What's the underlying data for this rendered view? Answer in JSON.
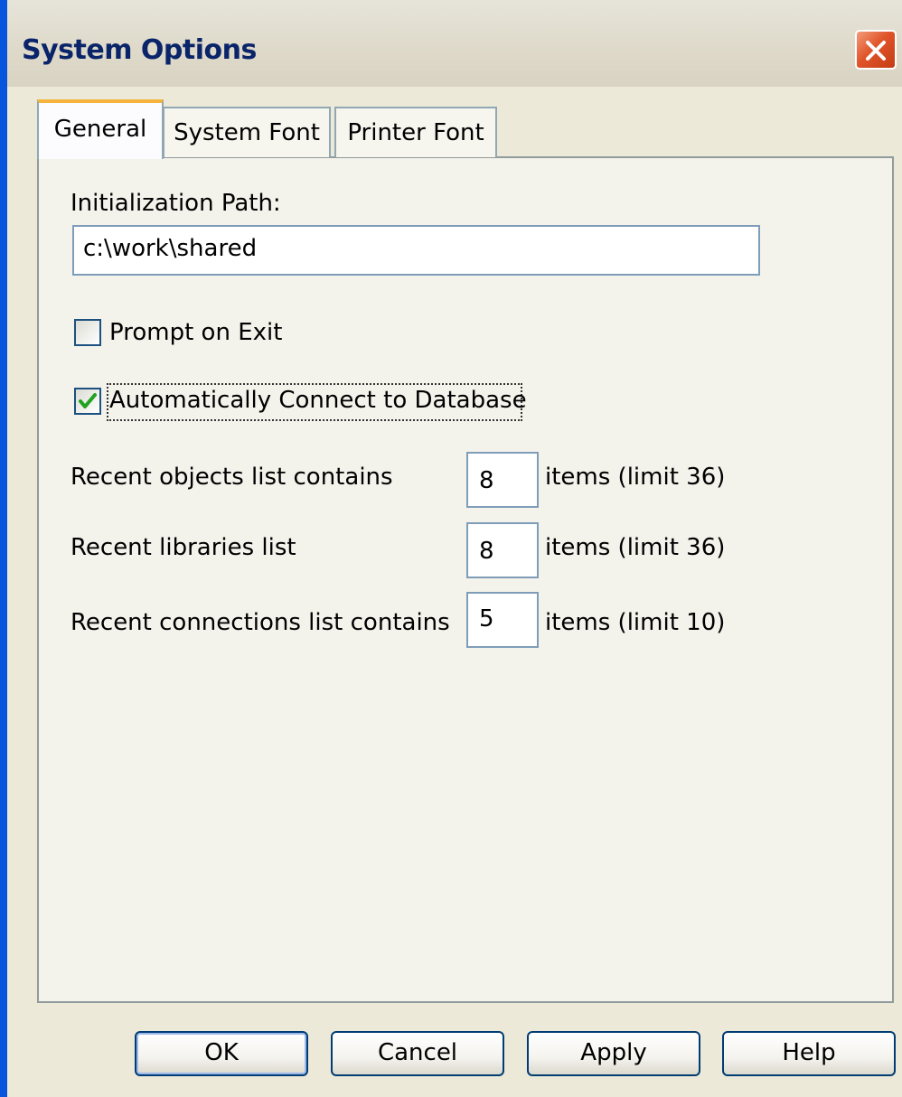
{
  "window": {
    "title": "System Options"
  },
  "tabs": [
    {
      "label": "General",
      "active": true
    },
    {
      "label": "System Font",
      "active": false
    },
    {
      "label": "Printer Font",
      "active": false
    }
  ],
  "general": {
    "init_path_label": "Initialization Path:",
    "init_path_value": "c:\\work\\shared",
    "prompt_on_exit": {
      "label": "Prompt on Exit",
      "checked": false
    },
    "auto_connect": {
      "label": "Automatically Connect to Database",
      "checked": true
    },
    "recent_objects": {
      "label": "Recent objects list contains",
      "value": "8",
      "suffix": "items (limit 36)"
    },
    "recent_libraries": {
      "label": "Recent libraries list",
      "value": "8",
      "suffix": "items (limit 36)"
    },
    "recent_connections": {
      "label": "Recent connections list contains",
      "value": "5",
      "suffix": "items (limit 10)"
    }
  },
  "buttons": {
    "ok": "OK",
    "cancel": "Cancel",
    "apply": "Apply",
    "help": "Help"
  },
  "colors": {
    "title_text": "#0a246a",
    "window_border": "#0855dd",
    "close_button": "#e0542a",
    "active_tab_highlight": "#f6b43c",
    "checkmark": "#21a121"
  },
  "icons": {
    "close": "close-icon",
    "check": "checkmark-icon"
  }
}
